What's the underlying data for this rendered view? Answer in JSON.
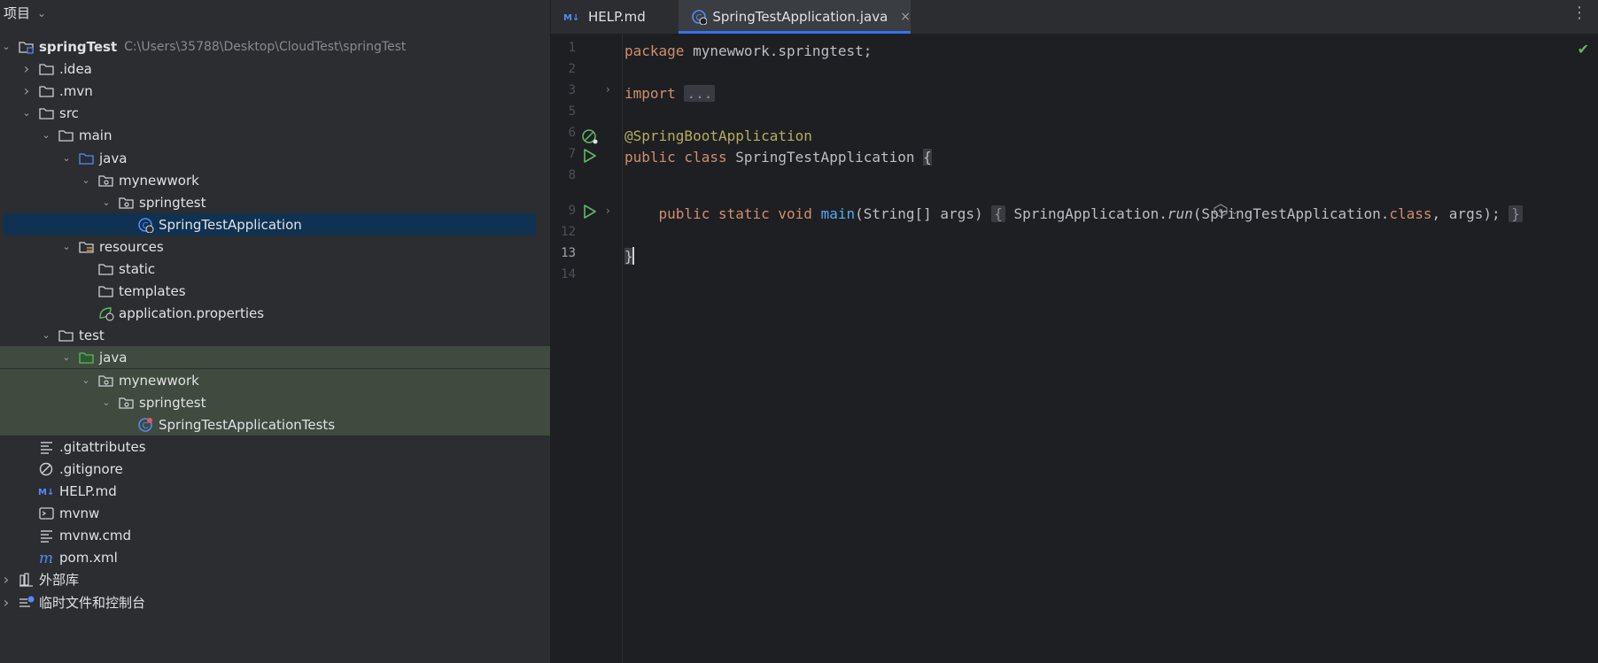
{
  "project_panel": {
    "title": "项目",
    "tree": [
      {
        "label": "springTest",
        "path": "C:\\Users\\35788\\Desktop\\CloudTest\\springTest",
        "icon": "module-folder-icon",
        "depth": 0,
        "expanded": true
      },
      {
        "label": ".idea",
        "icon": "folder-icon",
        "depth": 1,
        "expanded": false
      },
      {
        "label": ".mvn",
        "icon": "folder-icon",
        "depth": 1,
        "expanded": false
      },
      {
        "label": "src",
        "icon": "folder-icon",
        "depth": 1,
        "expanded": true
      },
      {
        "label": "main",
        "icon": "folder-icon",
        "depth": 2,
        "expanded": true
      },
      {
        "label": "java",
        "icon": "source-root-icon",
        "depth": 3,
        "expanded": true
      },
      {
        "label": "mynewwork",
        "icon": "package-icon",
        "depth": 4,
        "expanded": true
      },
      {
        "label": "springtest",
        "icon": "package-icon",
        "depth": 5,
        "expanded": true
      },
      {
        "label": "SpringTestApplication",
        "icon": "spring-boot-class-icon",
        "depth": 6,
        "selected": true
      },
      {
        "label": "resources",
        "icon": "resources-folder-icon",
        "depth": 3,
        "expanded": true
      },
      {
        "label": "static",
        "icon": "folder-icon",
        "depth": 4
      },
      {
        "label": "templates",
        "icon": "folder-icon",
        "depth": 4
      },
      {
        "label": "application.properties",
        "icon": "spring-properties-icon",
        "depth": 4
      },
      {
        "label": "test",
        "icon": "folder-icon",
        "depth": 2,
        "expanded": true
      },
      {
        "label": "java",
        "icon": "test-root-icon",
        "depth": 3,
        "expanded": true,
        "test": true
      },
      {
        "label": "mynewwork",
        "icon": "package-icon",
        "depth": 4,
        "expanded": true,
        "test": true
      },
      {
        "label": "springtest",
        "icon": "package-icon",
        "depth": 5,
        "expanded": true,
        "test": true
      },
      {
        "label": "SpringTestApplicationTests",
        "icon": "test-class-icon",
        "depth": 6,
        "test": true
      },
      {
        "label": ".gitattributes",
        "icon": "text-file-icon",
        "depth": 1
      },
      {
        "label": ".gitignore",
        "icon": "ignore-file-icon",
        "depth": 1
      },
      {
        "label": "HELP.md",
        "icon": "markdown-icon",
        "depth": 1
      },
      {
        "label": "mvnw",
        "icon": "terminal-file-icon",
        "depth": 1
      },
      {
        "label": "mvnw.cmd",
        "icon": "text-file-icon",
        "depth": 1
      },
      {
        "label": "pom.xml",
        "icon": "maven-icon",
        "depth": 1
      },
      {
        "label": "外部库",
        "icon": "libraries-icon",
        "depth": 0,
        "expanded": false
      },
      {
        "label": "临时文件和控制台",
        "icon": "scratches-icon",
        "depth": 0,
        "expanded": false
      }
    ]
  },
  "editor": {
    "tabs": [
      {
        "label": "HELP.md",
        "icon": "markdown-icon",
        "active": false
      },
      {
        "label": "SpringTestApplication.java",
        "icon": "spring-boot-class-icon",
        "active": true,
        "close": "×"
      }
    ],
    "line_numbers": [
      "1",
      "2",
      "3",
      "5",
      "6",
      "7",
      "8",
      "9",
      "12",
      "13",
      "14"
    ],
    "current_line": "13",
    "code": {
      "l1_kw": "package",
      "l1_rest": " mynewwork.springtest;",
      "l3_kw": "import",
      "l3_fold": "...",
      "l6_ann": "@SpringBootApplication",
      "l7_kw": "public class",
      "l7_name": " SpringTestApplication ",
      "l7_brace": "{",
      "l9_indent": "    ",
      "l9_kw": "public static void",
      "l9_sp": " ",
      "l9_fn": "main",
      "l9_args": "(String[] args) ",
      "l9_fold_open": "{",
      "l9_call_a": " SpringApplication.",
      "l9_run": "run",
      "l9_call_b": "(SpringTestApplication.",
      "l9_class": "class",
      "l9_call_c": ", args); ",
      "l9_fold_close": "}",
      "l13_brace": "}"
    }
  },
  "colors": {
    "accent": "#3574f0",
    "run": "#5fb865",
    "selection": "#0f3252",
    "test_bg": "#3e4b3e"
  }
}
